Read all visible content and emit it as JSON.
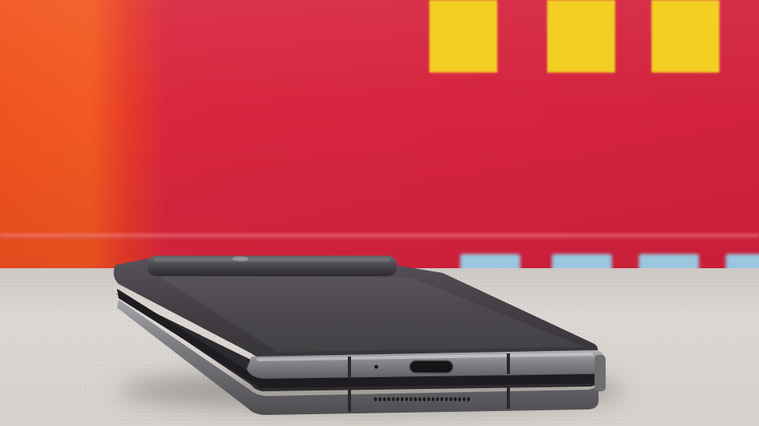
{
  "scene": {
    "subject": "folded-smartphone",
    "colors": {
      "backdrop_red": "#d6243f",
      "backdrop_orange": "#f0541e",
      "stripe_yellow": "#f3cf24",
      "tile_blue": "#9ac6df",
      "table_gray": "#d8d4d0",
      "phone_body": "#3f3c3f",
      "phone_frame": "#8a898d"
    }
  }
}
